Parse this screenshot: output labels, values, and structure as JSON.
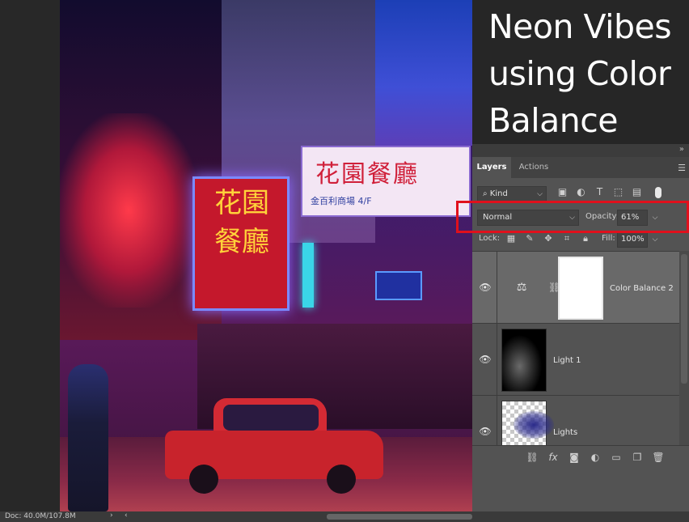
{
  "overlay_title": {
    "line1": "Neon Vibes",
    "line2": "using Color",
    "line3": "Balance"
  },
  "photo": {
    "sign_white_text": "花園餐廳",
    "sign_white_sub": "金百利商場 4/F",
    "sign_red_text": "花園餐廳"
  },
  "layers_panel": {
    "collapse_icon": "double-chevron",
    "tabs": [
      {
        "label": "Layers",
        "active": true
      },
      {
        "label": "Actions",
        "active": false
      }
    ],
    "menu_icon": "hamburger",
    "filter": {
      "kind_label": "Kind",
      "search_icon": "search"
    },
    "blend_mode": "Normal",
    "opacity_label": "Opacity:",
    "opacity_value": "61%",
    "lock_label": "Lock:",
    "fill_label": "Fill:",
    "fill_value": "100%",
    "layers": [
      {
        "name": "Color Balance 2",
        "type": "adjustment",
        "visible": true,
        "selected": true
      },
      {
        "name": "Light 1",
        "type": "pixel",
        "visible": true,
        "selected": false
      },
      {
        "name": "Lights",
        "type": "pixel",
        "visible": true,
        "selected": false
      }
    ],
    "bottom_icons": [
      "link",
      "fx",
      "mask",
      "adjustment",
      "folder",
      "new-layer",
      "trash"
    ]
  },
  "status_bar": {
    "doc_text": "Doc: 40.0M/107.8M"
  },
  "colors": {
    "highlight": "#e0101c",
    "panel_bg": "#535353"
  }
}
